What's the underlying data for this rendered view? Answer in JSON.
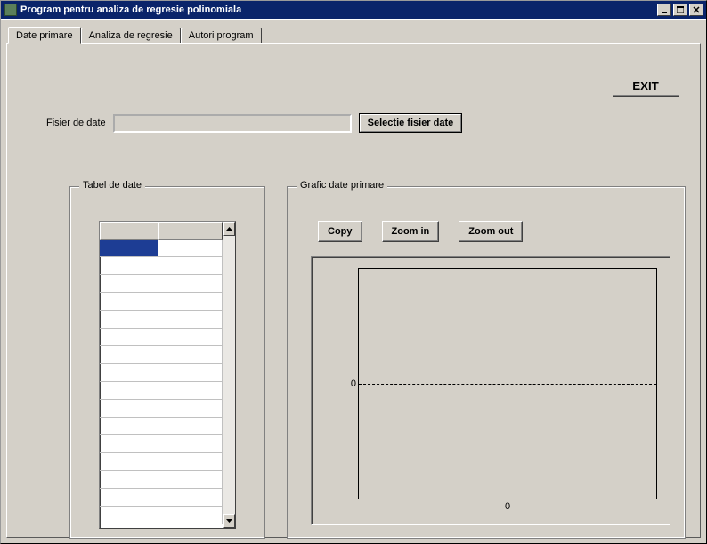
{
  "window": {
    "title": "Program pentru analiza de regresie polinomiala"
  },
  "tabs": [
    {
      "label": "Date  primare"
    },
    {
      "label": "Analiza de regresie"
    },
    {
      "label": "Autori program"
    }
  ],
  "exit_label": "EXIT",
  "file": {
    "label": "Fisier de date",
    "value": "",
    "button": "Selectie fisier date"
  },
  "groups": {
    "tabel": "Tabel de date",
    "grafic": "Grafic date primare"
  },
  "grafic_buttons": {
    "copy": "Copy",
    "zoom_in": "Zoom in",
    "zoom_out": "Zoom out"
  },
  "chart_data": {
    "type": "scatter",
    "x": [],
    "y": [],
    "xlabel": "",
    "ylabel": "",
    "xlim": [
      0,
      0
    ],
    "ylim": [
      0,
      0
    ],
    "x_ticks": [
      "0"
    ],
    "y_ticks": [
      "0"
    ]
  }
}
